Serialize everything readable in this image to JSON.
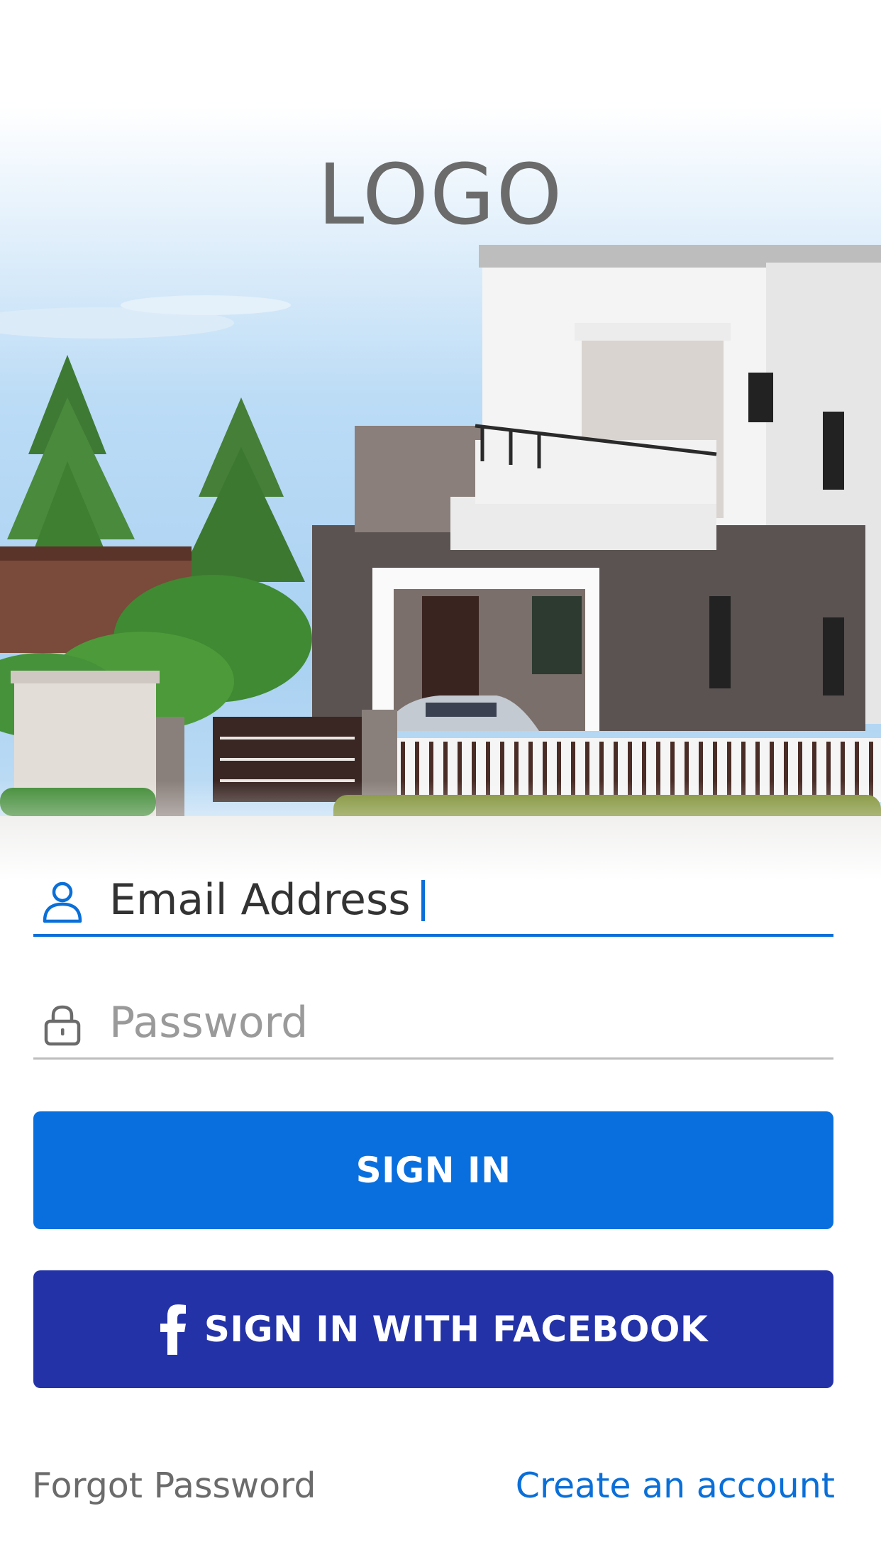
{
  "header": {
    "logo_text": "LOGO"
  },
  "login": {
    "email_value": "Email Address",
    "password_placeholder": "Password",
    "signin_label": "SIGN IN",
    "facebook_label": "SIGN IN WITH FACEBOOK"
  },
  "footer": {
    "forgot_label": "Forgot Password",
    "create_label": "Create an account"
  },
  "icons": {
    "email": "user-icon",
    "password": "lock-icon",
    "facebook": "facebook-icon"
  },
  "colors": {
    "primary": "#0a6fde",
    "facebook": "#2432a8",
    "link": "#0a6fd8",
    "muted": "#6b6b6b"
  }
}
